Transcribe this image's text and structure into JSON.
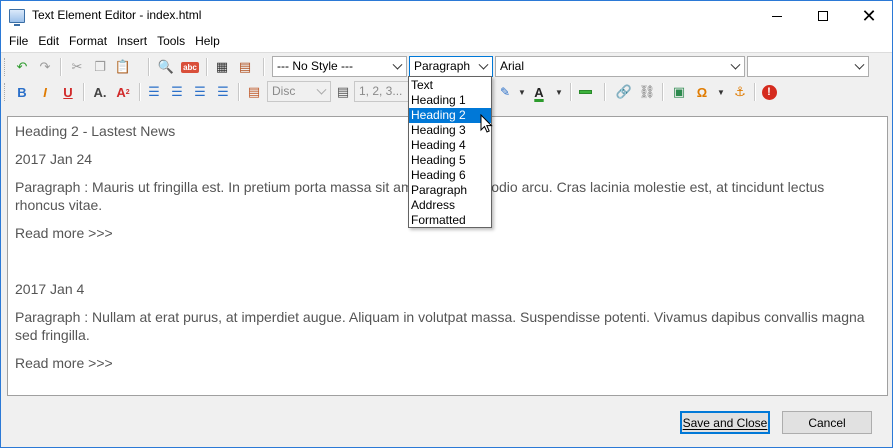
{
  "window": {
    "title": "Text Element Editor - index.html",
    "accent_color": "#2b79d6"
  },
  "menu": {
    "items": [
      "File",
      "Edit",
      "Format",
      "Insert",
      "Tools",
      "Help"
    ]
  },
  "toolbar": {
    "style_combo": "--- No Style ---",
    "block_combo": "Paragraph",
    "font_combo": "Arial",
    "size_combo": "",
    "list_style_combo": "Disc",
    "list_number_combo": "1, 2, 3...",
    "icons": [
      "undo-icon",
      "redo-icon",
      "cut-icon",
      "copy-icon",
      "paste-icon",
      "find-icon",
      "spellcheck-icon",
      "select-all-icon",
      "clear-format-icon",
      "bold-icon",
      "italic-icon",
      "underline-icon",
      "font-size-icon",
      "superscript-icon",
      "align-left-icon",
      "align-center-icon",
      "align-right-icon",
      "justify-icon",
      "list-icon",
      "numbered-list-icon",
      "highlight-icon",
      "font-color-icon",
      "horizontal-rule-icon",
      "link-icon",
      "unlink-icon",
      "image-icon",
      "special-char-icon",
      "anchor-icon",
      "help-icon"
    ]
  },
  "dropdown": {
    "options": [
      "Text",
      "Heading 1",
      "Heading 2",
      "Heading 3",
      "Heading 4",
      "Heading 5",
      "Heading 6",
      "Paragraph",
      "Address",
      "Formatted"
    ],
    "highlighted": "Heading 2",
    "highlight_color": "#0078d7"
  },
  "editor": {
    "heading": "Heading 2 - Lastest News",
    "date1": "2017 Jan 24",
    "para1": "Paragraph : Mauris ut fringilla est. In pretium porta massa sit amet Proin sed odio arcu. Cras lacinia molestie est, at tincidunt lectus rhoncus vitae.",
    "read_more1": "Read more >>>",
    "date2": "2017 Jan 4",
    "para2": "Paragraph : Nullam at erat purus, at imperdiet augue. Aliquam in volutpat massa. Suspendisse potenti. Vivamus dapibus convallis magna sed fringilla.",
    "read_more2": "Read more >>>"
  },
  "buttons": {
    "save": "Save and Close",
    "cancel": "Cancel"
  }
}
